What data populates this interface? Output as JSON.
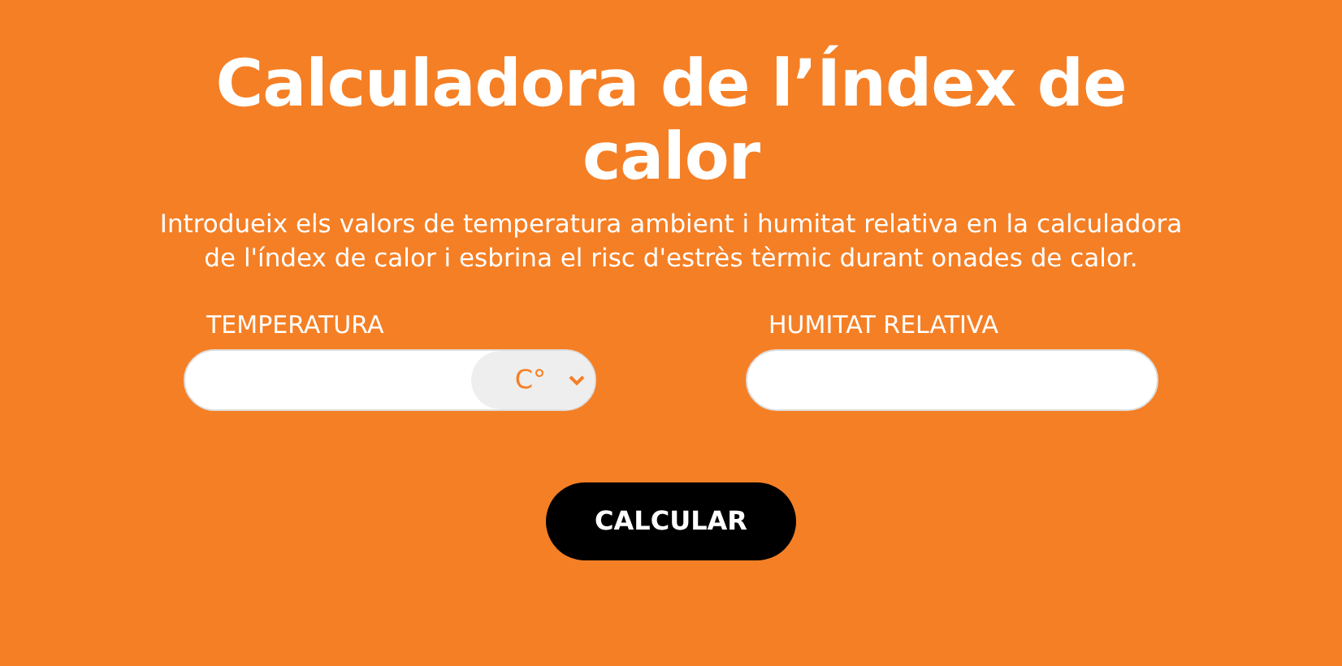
{
  "title": "Calculadora de l’Índex de calor",
  "description": "Introdueix els valors de temperatura ambient i humitat relativa en la calculadora de l'índex de calor i esbrina el risc d'estrès tèrmic durant onades de calor.",
  "fields": [
    {
      "label": "TEMPERATURA",
      "kind": "unit",
      "unit": "C°"
    },
    {
      "label": "HUMITAT RELATIVA",
      "kind": "plain"
    }
  ],
  "button": "CALCULAR"
}
